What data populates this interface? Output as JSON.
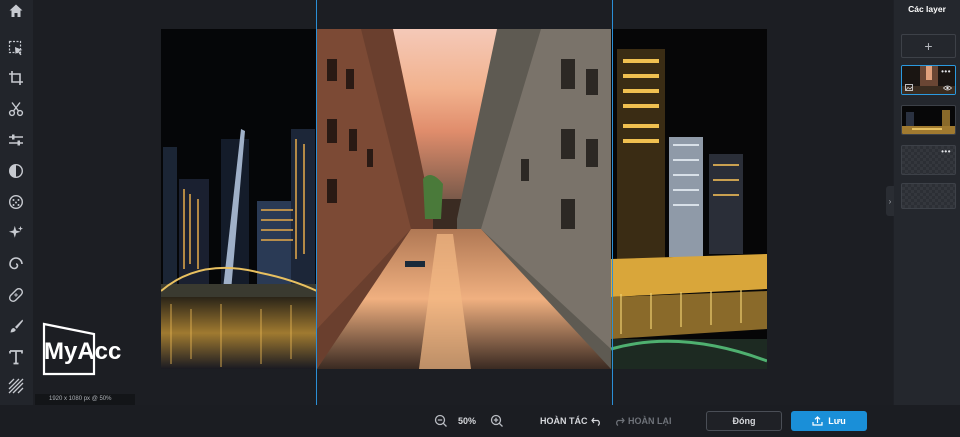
{
  "toolbar": {
    "tools": [
      {
        "name": "home-icon"
      },
      {
        "name": "select-arrow-icon"
      },
      {
        "name": "crop-icon"
      },
      {
        "name": "scissors-icon"
      },
      {
        "name": "adjust-sliders-icon"
      },
      {
        "name": "contrast-icon"
      },
      {
        "name": "texture-icon"
      },
      {
        "name": "sparkle-icon"
      },
      {
        "name": "swirl-icon"
      },
      {
        "name": "bandage-icon"
      },
      {
        "name": "brush-icon"
      },
      {
        "name": "text-icon"
      },
      {
        "name": "pattern-icon"
      }
    ]
  },
  "canvas": {
    "info": "1920 x 1080 px @ 50%"
  },
  "watermark": {
    "text": "MyAcc"
  },
  "bottombar": {
    "zoom_value": "50%",
    "undo_label": "HOÀN TÁC",
    "redo_label": "HOÀN LẠI",
    "close_label": "Đóng",
    "save_label": "Lưu"
  },
  "layers_panel": {
    "title": "Các layer",
    "add_label": "+",
    "layers": [
      {
        "more": "•••",
        "active": true
      },
      {
        "more": "",
        "active": false
      },
      {
        "more": "•••",
        "active": false
      },
      {
        "more": "",
        "active": false
      }
    ]
  },
  "colors": {
    "accent": "#1a8fd8",
    "guide": "#2b8fd6",
    "background": "#1e2026"
  }
}
